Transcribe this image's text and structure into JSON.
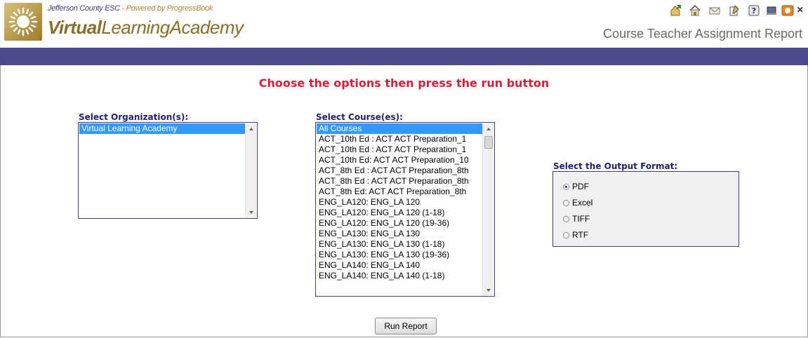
{
  "header": {
    "org_name": "Jefferson County ESC",
    "separator": " - ",
    "powered_by": "Powered by ProgressBook",
    "brand_bold": "Virtual",
    "brand_light": "LearningAcademy",
    "report_title": "Course Teacher Assignment Report",
    "close_symbol": "×"
  },
  "icons": [
    "up-arrow-house-icon",
    "home-icon",
    "mail-icon",
    "document-edit-icon",
    "help-icon",
    "computer-icon",
    "orange-app-icon"
  ],
  "colors": {
    "bar": "#4b4a8c",
    "instruction": "#d0203a",
    "label": "#1f1f6b",
    "brand": "#8a6d28",
    "selected": "#3399ff"
  },
  "instruction": "Choose the options then press the run button",
  "organizations": {
    "label": "Select Organization(s):",
    "items": [
      "Virtual Learning Academy"
    ],
    "selected_index": 0
  },
  "courses": {
    "label": "Select Course(es):",
    "items": [
      "All Courses",
      "ACT_10th Ed : ACT ACT Preparation_1",
      "ACT_10th Ed : ACT ACT Preparation_1",
      "ACT_10th Ed: ACT ACT Preparation_10",
      "ACT_8th Ed : ACT ACT Preparation_8th",
      "ACT_8th Ed : ACT ACT Preparation_8th",
      "ACT_8th Ed: ACT ACT Preparation_8th",
      "ENG_LA120: ENG_LA 120",
      "ENG_LA120: ENG_LA 120 (1-18)",
      "ENG_LA120: ENG_LA 120 (19-36)",
      "ENG_LA130: ENG_LA 130",
      "ENG_LA130: ENG_LA 130 (1-18)",
      "ENG_LA130: ENG_LA 130 (19-36)",
      "ENG_LA140: ENG_LA 140",
      "ENG_LA140: ENG_LA 140 (1-18)"
    ],
    "selected_index": 0
  },
  "output_format": {
    "label": "Select the Output Format:",
    "options": [
      "PDF",
      "Excel",
      "TIFF",
      "RTF"
    ],
    "selected": "PDF"
  },
  "run_button": "Run Report"
}
